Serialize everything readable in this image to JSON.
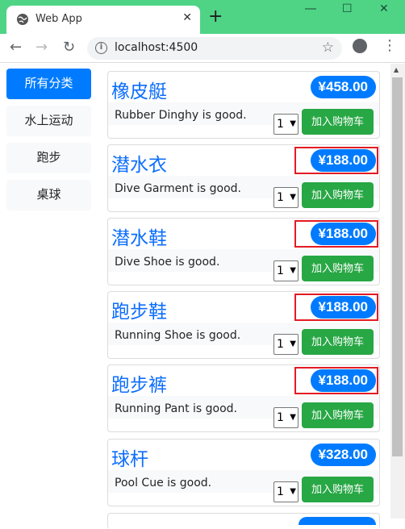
{
  "browser": {
    "tab_title": "Web App",
    "url": "localhost:4500",
    "new_tab_symbol": "+",
    "close_symbol": "✕"
  },
  "categories": [
    {
      "label": "所有分类",
      "active": true
    },
    {
      "label": "水上运动",
      "active": false
    },
    {
      "label": "跑步",
      "active": false
    },
    {
      "label": "桌球",
      "active": false
    }
  ],
  "products": [
    {
      "name": "橡皮艇",
      "price": "¥458.00",
      "description": "Rubber Dinghy is good.",
      "quantity": "1",
      "highlighted": false
    },
    {
      "name": "潜水衣",
      "price": "¥188.00",
      "description": "Dive Garment is good.",
      "quantity": "1",
      "highlighted": true
    },
    {
      "name": "潜水鞋",
      "price": "¥188.00",
      "description": "Dive Shoe is good.",
      "quantity": "1",
      "highlighted": true
    },
    {
      "name": "跑步鞋",
      "price": "¥188.00",
      "description": "Running Shoe is good.",
      "quantity": "1",
      "highlighted": true
    },
    {
      "name": "跑步裤",
      "price": "¥188.00",
      "description": "Running Pant is good.",
      "quantity": "1",
      "highlighted": true
    },
    {
      "name": "球杆",
      "price": "¥328.00",
      "description": "Pool Cue is good.",
      "quantity": "1",
      "highlighted": false
    }
  ],
  "add_to_cart_label": "加入购物车",
  "colors": {
    "titlebar": "#4fd486",
    "primary": "#007bff",
    "success": "#28a745",
    "highlight": "#e31b23"
  }
}
